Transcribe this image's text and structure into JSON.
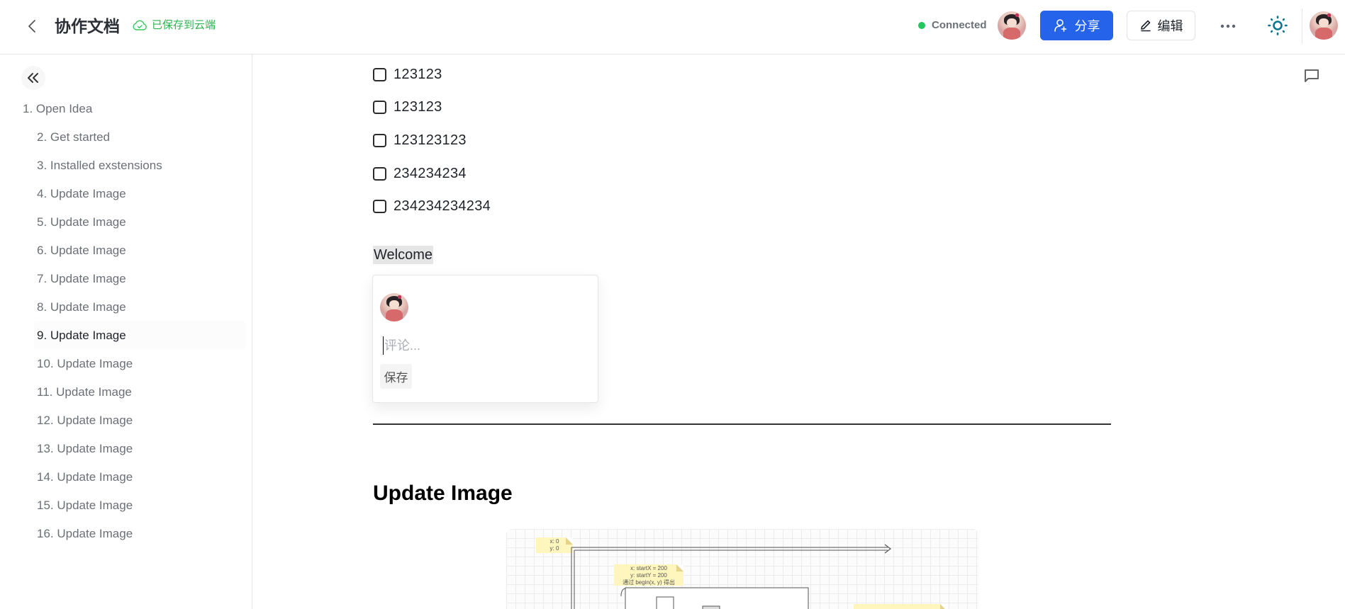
{
  "header": {
    "back_label": "back",
    "title": "协作文档",
    "save_status": "已保存到云端",
    "connection_status": "Connected",
    "connection_color": "#22c55e",
    "share_label": "分享",
    "share_color": "#2563eb",
    "edit_label": "编辑",
    "more_icon": "more-horizontal-icon",
    "theme_icon": "sun-icon",
    "theme_color": "#0e7490"
  },
  "sidebar": {
    "collapse_icon": "chevrons-left-icon",
    "toc": [
      {
        "label": "1. Open Idea",
        "level": 1
      },
      {
        "label": "2. Get started",
        "level": 2
      },
      {
        "label": "3. Installed exstensions",
        "level": 2
      },
      {
        "label": "4. Update Image",
        "level": 2
      },
      {
        "label": "5. Update Image",
        "level": 2
      },
      {
        "label": "6. Update Image",
        "level": 2
      },
      {
        "label": "7. Update Image",
        "level": 2
      },
      {
        "label": "8. Update Image",
        "level": 2
      },
      {
        "label": "9. Update Image",
        "level": 2,
        "active": true
      },
      {
        "label": "10. Update Image",
        "level": 2
      },
      {
        "label": "11. Update Image",
        "level": 2
      },
      {
        "label": "12. Update Image",
        "level": 2
      },
      {
        "label": "13. Update Image",
        "level": 2
      },
      {
        "label": "14. Update Image",
        "level": 2
      },
      {
        "label": "15. Update Image",
        "level": 2
      },
      {
        "label": "16. Update Image",
        "level": 2
      }
    ]
  },
  "document": {
    "tasks": [
      {
        "text": "123123",
        "checked": false
      },
      {
        "text": "123123",
        "checked": false
      },
      {
        "text": "123123123",
        "checked": false
      },
      {
        "text": "234234234",
        "checked": false
      },
      {
        "text": "234234234234",
        "checked": false
      }
    ],
    "highlighted_text": "Welcome",
    "comment_popup": {
      "placeholder": "评论...",
      "value": "",
      "save_label": "保存"
    },
    "section_heading": "Update Image",
    "diagram": {
      "note_origin": [
        "x:  0",
        "y:  0"
      ],
      "note_start": [
        "x:  startX = 200",
        "y:  startY = 200",
        "通过 begin(x, y) 得出"
      ]
    }
  }
}
